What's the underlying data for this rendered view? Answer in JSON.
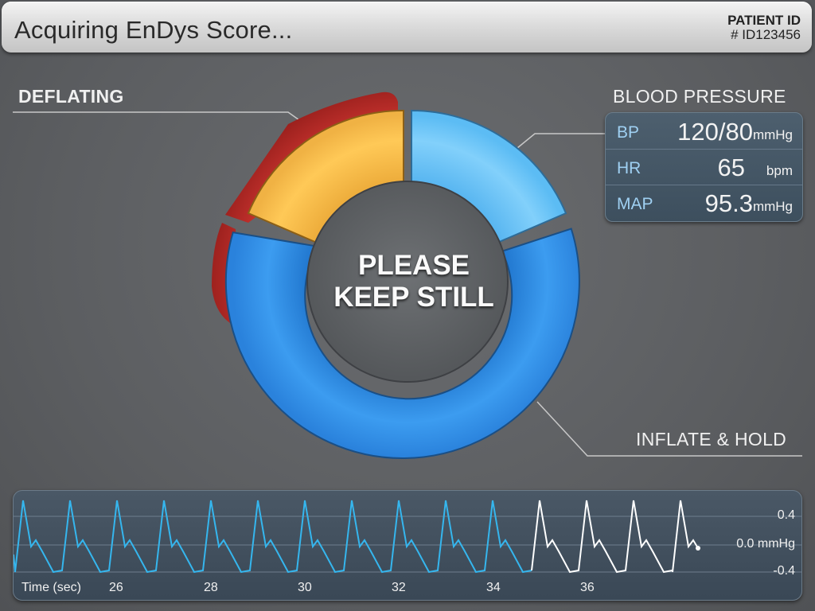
{
  "header": {
    "title": "Acquiring EnDys Score...",
    "patient_id_label": "PATIENT ID",
    "patient_id_value": "# ID123456"
  },
  "status": {
    "deflating_label": "DEFLATING",
    "blood_pressure_label": "BLOOD PRESSURE",
    "inflate_hold_label": "INFLATE & HOLD",
    "center_line1": "PLEASE",
    "center_line2": "KEEP STILL"
  },
  "vitals": [
    {
      "key": "BP",
      "value": "120/80",
      "unit": "mmHg"
    },
    {
      "key": "HR",
      "value": "65",
      "unit": "bpm"
    },
    {
      "key": "MAP",
      "value": "95.3",
      "unit": "mmHg"
    }
  ],
  "waveform": {
    "x_axis_label": "Time (sec)",
    "x_ticks": [
      "26",
      "28",
      "30",
      "32",
      "34",
      "36"
    ],
    "y_ticks": [
      "0.4",
      "0.0 mmHg",
      "-0.4"
    ]
  },
  "colors": {
    "deflate_red": "#b32a27",
    "deflate_amber": "#f5b94a",
    "bp_light_blue": "#6cc4f5",
    "inflate_blue": "#2f8ee6",
    "wave_cyan": "#35b6ee",
    "wave_white": "#ffffff"
  }
}
